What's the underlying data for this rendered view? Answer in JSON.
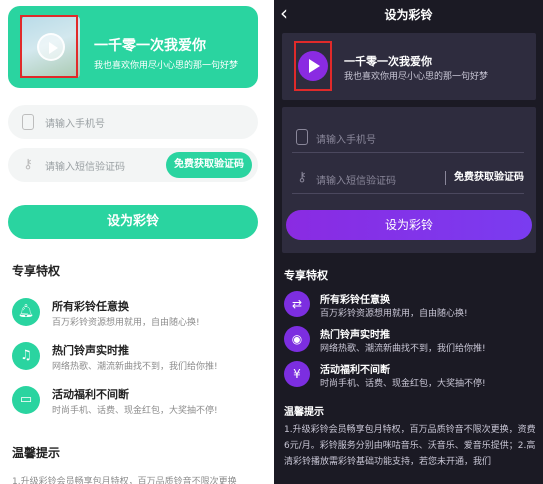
{
  "left": {
    "song": {
      "title": "一千零一次我爱你",
      "subtitle": "我也喜欢你用尽小心思的那一句好梦"
    },
    "phone_placeholder": "请输入手机号",
    "sms_placeholder": "请输入短信验证码",
    "get_code_label": "免费获取验证码",
    "submit_label": "设为彩铃",
    "privileges_title": "专享特权",
    "features": [
      {
        "title": "所有彩铃任意换",
        "desc": "百万彩铃资源想用就用，自由随心换!"
      },
      {
        "title": "热门铃声实时推",
        "desc": "网络热歌、潮流新曲找不到，我们给你推!"
      },
      {
        "title": "活动福利不间断",
        "desc": "时尚手机、话费、现金红包，大奖抽不停!"
      }
    ],
    "tips_title": "温馨提示",
    "tips_line": "1.升级彩铃会员畅享包月特权，百万品质铃音不限次更换"
  },
  "right": {
    "nav_title": "设为彩铃",
    "song": {
      "title": "一千零一次我爱你",
      "subtitle": "我也喜欢你用尽小心思的那一句好梦"
    },
    "phone_placeholder": "请输入手机号",
    "sms_placeholder": "请输入短信验证码",
    "get_code_label": "免费获取验证码",
    "submit_label": "设为彩铃",
    "privileges_title": "专享特权",
    "features": [
      {
        "title": "所有彩铃任意换",
        "desc": "百万彩铃资源想用就用，自由随心换!"
      },
      {
        "title": "热门铃声实时推",
        "desc": "网络热歌、潮流新曲找不到，我们给你推!"
      },
      {
        "title": "活动福利不间断",
        "desc": "时尚手机、话费、现金红包，大奖抽不停!"
      }
    ],
    "tips_title": "温馨提示",
    "tips": "1.升级彩铃会员畅享包月特权，百万品质铃音不限次更换，资费6元/月。彩铃服务分别由咪咕音乐、沃音乐、爱音乐提供；2.高清彩铃播放需彩铃基础功能支持，若您未开通，我们"
  },
  "colors": {
    "green": "#2ad4a0",
    "purple": "#8a2be2",
    "dark_bg": "#1b1a24",
    "card_bg": "#2e2c3e",
    "highlight": "#e02a2a"
  }
}
